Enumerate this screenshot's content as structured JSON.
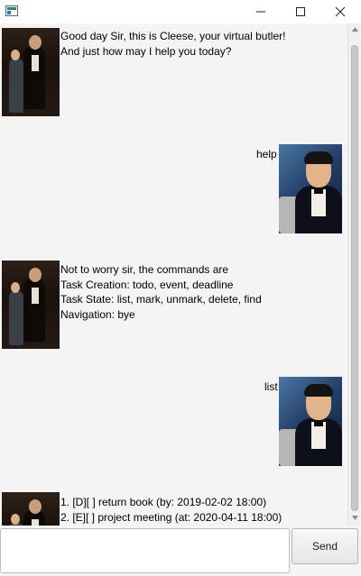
{
  "window": {
    "title": "",
    "icon": "java-app-icon"
  },
  "conversation": [
    {
      "sender": "cleese",
      "lines": [
        "Good day Sir, this is Cleese, your virtual butler!",
        "And just how may I help you today?"
      ]
    },
    {
      "sender": "user",
      "lines": [
        "help"
      ]
    },
    {
      "sender": "cleese",
      "lines": [
        "Not to worry sir, the commands are",
        "Task Creation: todo, event, deadline",
        "Task State: list, mark, unmark, delete, find",
        "Navigation: bye"
      ]
    },
    {
      "sender": "user",
      "lines": [
        "list"
      ]
    },
    {
      "sender": "cleese",
      "lines": [
        "1. [D][ ] return book (by: 2019-02-02 18:00)",
        "2. [E][ ] project meeting (at: 2020-04-11 18:00)"
      ]
    }
  ],
  "input": {
    "value": "",
    "placeholder": ""
  },
  "send_button": {
    "label": "Send"
  }
}
